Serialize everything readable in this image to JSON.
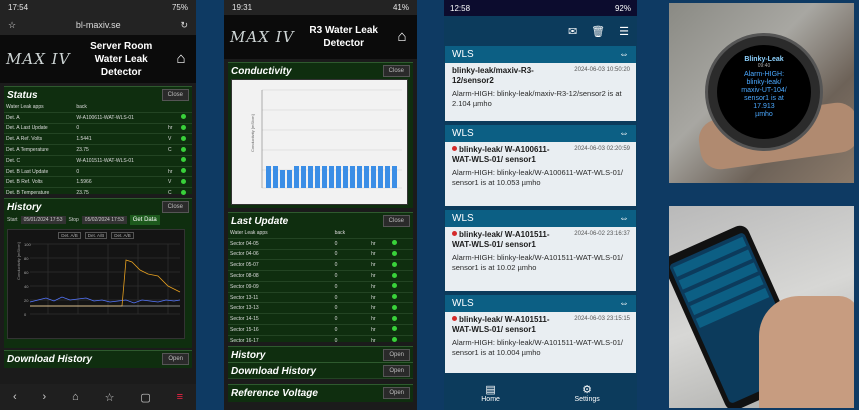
{
  "phone1": {
    "status_bar": {
      "time": "17:54",
      "battery": "75%"
    },
    "url": "bl-maxiv.se",
    "logo": "MAX IV",
    "title_line1": "Server Room",
    "title_line2": "Water Leak Detector",
    "status": {
      "heading": "Status",
      "close_label": "Close",
      "header": [
        "Water Leak apps",
        "back",
        ""
      ],
      "rows": [
        [
          "Det. A",
          "W-A100611-WAT-WLS-01",
          ""
        ],
        [
          "Det. A Last Update",
          "0",
          "hr"
        ],
        [
          "Det. A Ref. Volts",
          "1.5441",
          "V"
        ],
        [
          "Det. A Temperature",
          "23.75",
          "C"
        ],
        [
          "Det. C",
          "W-A101511-WAT-WLS-01",
          ""
        ],
        [
          "Det. B Last Update",
          "0",
          "hr"
        ],
        [
          "Det. B Ref. Volts",
          "1.5966",
          "V"
        ],
        [
          "Det. B Temperature",
          "23.75",
          "C"
        ]
      ]
    },
    "history": {
      "heading": "History",
      "close_label": "Close",
      "start_label": "Start",
      "start_value": "05/01/2024 17:53",
      "stop_label": "Stop",
      "stop_value": "05/02/2024 17:53",
      "get_data_label": "Get Data",
      "legend": [
        "Det. A/B",
        "Det. A/B",
        "Det. A/B"
      ],
      "y_label": "Conductivity [mS/cm]",
      "y_ticks": [
        "100",
        "80",
        "60",
        "40",
        "20",
        "0"
      ]
    },
    "download": {
      "heading": "Download History",
      "open_label": "Open"
    }
  },
  "phone2": {
    "status_bar": {
      "time": "19:31",
      "battery": "41%"
    },
    "logo": "MAX IV",
    "title_line1": "R3 Water Leak",
    "title_line2": "Detector",
    "conductivity": {
      "heading": "Conductivity",
      "close_label": "Close",
      "y_label": "Conductivity [mS/cm]"
    },
    "last_update": {
      "heading": "Last Update",
      "close_label": "Close",
      "header": [
        "Water Leak apps",
        "back",
        ""
      ],
      "rows": [
        [
          "Sector 04-05",
          "0",
          "hr"
        ],
        [
          "Sector 04-06",
          "0",
          "hr"
        ],
        [
          "Sector 05-07",
          "0",
          "hr"
        ],
        [
          "Sector 08-08",
          "0",
          "hr"
        ],
        [
          "Sector 09-09",
          "0",
          "hr"
        ],
        [
          "Sector 13-11",
          "0",
          "hr"
        ],
        [
          "Sector 13-13",
          "0",
          "hr"
        ],
        [
          "Sector 14-15",
          "0",
          "hr"
        ],
        [
          "Sector 15-16",
          "0",
          "hr"
        ],
        [
          "Sector 16-17",
          "0",
          "hr"
        ],
        [
          "Sector 18-19",
          "0",
          "hr"
        ],
        [
          "Sector 19-20",
          "0",
          "hr"
        ],
        [
          "Sector 20-01",
          "0",
          "hr"
        ]
      ]
    },
    "history": {
      "heading": "History",
      "open_label": "Open"
    },
    "download": {
      "heading": "Download History",
      "open_label": "Open"
    },
    "reference": {
      "heading": "Reference Voltage",
      "open_label": "Open"
    }
  },
  "phone3": {
    "status_bar": {
      "time": "12:58",
      "battery": "92%"
    },
    "cards": [
      {
        "header": "WLS",
        "title": "blinky-leak/maxiv-R3-12/sensor2",
        "time": "2024-06-03 10:50:20",
        "message": "Alarm-HIGH: blinky-leak/maxiv-R3-12/sensor2 is at 2.104 µmho",
        "dot": false
      },
      {
        "header": "WLS",
        "title": "blinky-leak/ W-A100611-WAT-WLS-01/ sensor1",
        "time": "2024-06-03 02:20:59",
        "message": "Alarm-HIGH: blinky-leak/W-A100611-WAT-WLS-01/ sensor1 is at 10.053 µmho",
        "dot": true
      },
      {
        "header": "WLS",
        "title": "blinky-leak/ W-A101511-WAT-WLS-01/ sensor1",
        "time": "2024-06-02 23:16:37",
        "message": "Alarm-HIGH: blinky-leak/W-A101511-WAT-WLS-01/ sensor1 is at 10.02 µmho",
        "dot": true
      },
      {
        "header": "WLS",
        "title": "blinky-leak/ W-A101511-WAT-WLS-01/ sensor1",
        "time": "2024-06-03 23:15:15",
        "message": "Alarm-HIGH: blinky-leak/W-A101511-WAT-WLS-01/ sensor1 is at 10.004 µmho",
        "dot": true
      }
    ],
    "nav": {
      "home": "Home",
      "settings": "Settings"
    }
  },
  "watch": {
    "title": "Blinky-Leak",
    "time": "09:40",
    "message_lines": [
      "Alarm-HIGH:",
      "blinky-leak/",
      "maxiv-UT-104/",
      "sensor1 is at",
      "17.913",
      "µmho"
    ]
  }
}
